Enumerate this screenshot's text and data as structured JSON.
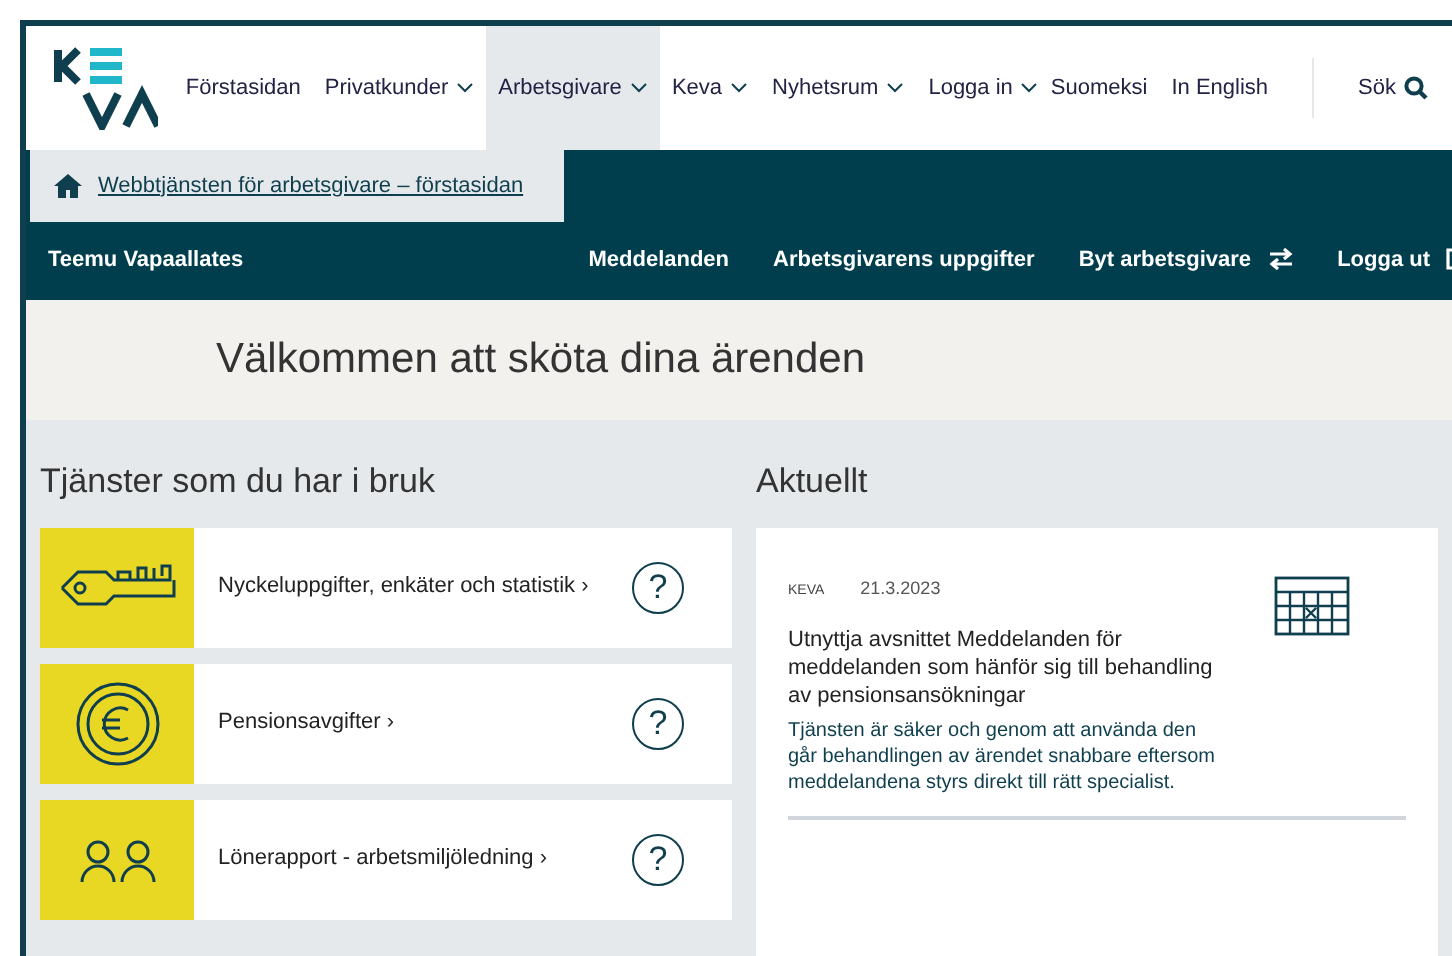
{
  "header": {
    "nav": [
      {
        "label": "Förstasidan",
        "dropdown": false,
        "selected": false
      },
      {
        "label": "Privatkunder",
        "dropdown": true,
        "selected": false
      },
      {
        "label": "Arbetsgivare",
        "dropdown": true,
        "selected": true
      },
      {
        "label": "Keva",
        "dropdown": true,
        "selected": false
      },
      {
        "label": "Nyhetsrum",
        "dropdown": true,
        "selected": false
      },
      {
        "label": "Logga in",
        "dropdown": true,
        "selected": false
      }
    ],
    "languages": [
      "Suomeksi",
      "In English"
    ],
    "search": "Sök"
  },
  "dropdown": {
    "link": "Webbtjänsten för arbetsgivare – förstasidan"
  },
  "user_bar": {
    "user": "Teemu Vapaallates",
    "links": [
      {
        "label": "Meddelanden",
        "kind": "plain"
      },
      {
        "label": "Arbetsgivarens uppgifter",
        "kind": "plain"
      },
      {
        "label": "Byt arbetsgivare",
        "kind": "switch"
      },
      {
        "label": "Logga ut",
        "kind": "logout"
      }
    ]
  },
  "welcome": "Välkommen att sköta dina ärenden",
  "services": {
    "title": "Tjänster som du har i bruk",
    "items": [
      {
        "kind": "key",
        "label": "Nyckeluppgifter, enkäter och statistik",
        "arrow": "›",
        "help": "?"
      },
      {
        "kind": "euro",
        "label": "Pensionsavgifter",
        "arrow": "›",
        "help": "?"
      },
      {
        "kind": "people",
        "label": "Lönerapport - arbetsmiljöledning",
        "arrow": "›",
        "help": "?"
      }
    ]
  },
  "news": {
    "title": "Aktuellt",
    "items": [
      {
        "source": "KEVA",
        "date": "21.3.2023",
        "headline": "Utnyttja avsnittet Meddelanden för meddelanden som hänför sig till behandling av pensionsansökningar",
        "body": "Tjänsten är säker och genom att använda den går behandlingen av ärendet snabbare eftersom meddelandena styrs direkt till rätt specialist."
      }
    ]
  }
}
